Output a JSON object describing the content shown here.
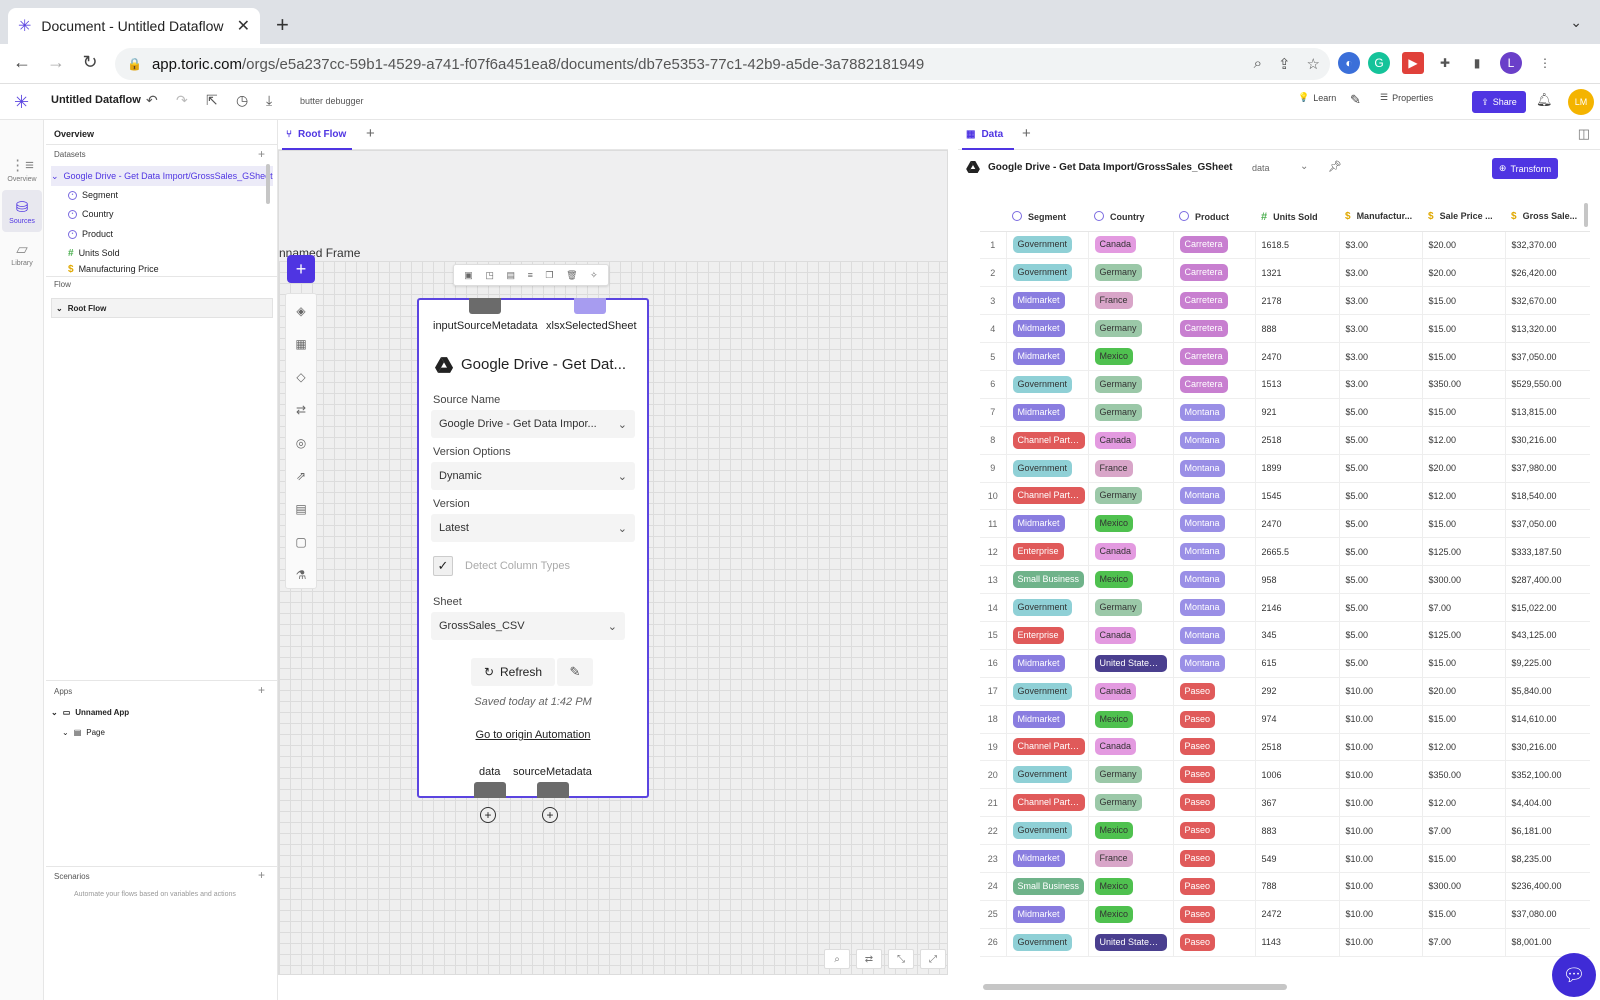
{
  "browser": {
    "tab_title": "Document - Untitled Dataflow",
    "url_host": "app.toric.com",
    "url_path": "/orgs/e5a237cc-59b1-4529-a741-f07f6a451ea8/documents/db7e5353-77c1-42b9-a5de-3a7882181949",
    "profile_initial": "L"
  },
  "header": {
    "doc_title": "Untitled Dataflow",
    "debugger_label": "butter debugger",
    "learn_label": "Learn",
    "properties_label": "Properties",
    "share_label": "Share",
    "avatar_initials": "LM"
  },
  "rail": {
    "overview": "Overview",
    "sources": "Sources",
    "library": "Library"
  },
  "left_panel": {
    "overview_title": "Overview",
    "datasets_label": "Datasets",
    "dataset_name": "Google Drive - Get Data Import/GrossSales_GSheet",
    "fields": [
      {
        "name": "Segment",
        "type": "text"
      },
      {
        "name": "Country",
        "type": "text"
      },
      {
        "name": "Product",
        "type": "text"
      },
      {
        "name": "Units Sold",
        "type": "number"
      },
      {
        "name": "Manufacturing Price",
        "type": "currency"
      }
    ],
    "flow_label": "Flow",
    "root_flow": "Root Flow",
    "apps_label": "Apps",
    "app_name": "Unnamed App",
    "page_name": "Page",
    "scenarios_label": "Scenarios",
    "scenarios_desc": "Automate your flows based on variables and actions"
  },
  "canvas": {
    "tab_label": "Root Flow",
    "frame_label": "nnamed Frame",
    "node": {
      "port_in_1": "inputSourceMetadata",
      "port_in_2": "xlsxSelectedSheet",
      "title": "Google Drive - Get Dat...",
      "source_name_label": "Source Name",
      "source_name_value": "Google Drive - Get Data Impor...",
      "version_options_label": "Version Options",
      "version_options_value": "Dynamic",
      "version_label": "Version",
      "version_value": "Latest",
      "detect_label": "Detect Column Types",
      "sheet_label": "Sheet",
      "sheet_value": "GrossSales_CSV",
      "refresh_label": "Refresh",
      "saved_text": "Saved today at 1:42 PM",
      "origin_link": "Go to origin Automation",
      "port_out_1": "data",
      "port_out_2": "sourceMetadata"
    }
  },
  "data_panel": {
    "tab_label": "Data",
    "dataset_name": "Google Drive - Get Data Import/GrossSales_GSheet",
    "output_label": "data",
    "transform_label": "Transform",
    "columns": [
      "Segment",
      "Country",
      "Product",
      "Units Sold",
      "Manufactur...",
      "Sale Price ...",
      "Gross Sale..."
    ],
    "rows": [
      [
        "Government",
        "Canada",
        "Carretera",
        "1618.5",
        "$3.00",
        "$20.00",
        "$32,370.00"
      ],
      [
        "Government",
        "Germany",
        "Carretera",
        "1321",
        "$3.00",
        "$20.00",
        "$26,420.00"
      ],
      [
        "Midmarket",
        "France",
        "Carretera",
        "2178",
        "$3.00",
        "$15.00",
        "$32,670.00"
      ],
      [
        "Midmarket",
        "Germany",
        "Carretera",
        "888",
        "$3.00",
        "$15.00",
        "$13,320.00"
      ],
      [
        "Midmarket",
        "Mexico",
        "Carretera",
        "2470",
        "$3.00",
        "$15.00",
        "$37,050.00"
      ],
      [
        "Government",
        "Germany",
        "Carretera",
        "1513",
        "$3.00",
        "$350.00",
        "$529,550.00"
      ],
      [
        "Midmarket",
        "Germany",
        "Montana",
        "921",
        "$5.00",
        "$15.00",
        "$13,815.00"
      ],
      [
        "Channel Partn...",
        "Canada",
        "Montana",
        "2518",
        "$5.00",
        "$12.00",
        "$30,216.00"
      ],
      [
        "Government",
        "France",
        "Montana",
        "1899",
        "$5.00",
        "$20.00",
        "$37,980.00"
      ],
      [
        "Channel Partn...",
        "Germany",
        "Montana",
        "1545",
        "$5.00",
        "$12.00",
        "$18,540.00"
      ],
      [
        "Midmarket",
        "Mexico",
        "Montana",
        "2470",
        "$5.00",
        "$15.00",
        "$37,050.00"
      ],
      [
        "Enterprise",
        "Canada",
        "Montana",
        "2665.5",
        "$5.00",
        "$125.00",
        "$333,187.50"
      ],
      [
        "Small Business",
        "Mexico",
        "Montana",
        "958",
        "$5.00",
        "$300.00",
        "$287,400.00"
      ],
      [
        "Government",
        "Germany",
        "Montana",
        "2146",
        "$5.00",
        "$7.00",
        "$15,022.00"
      ],
      [
        "Enterprise",
        "Canada",
        "Montana",
        "345",
        "$5.00",
        "$125.00",
        "$43,125.00"
      ],
      [
        "Midmarket",
        "United States ...",
        "Montana",
        "615",
        "$5.00",
        "$15.00",
        "$9,225.00"
      ],
      [
        "Government",
        "Canada",
        "Paseo",
        "292",
        "$10.00",
        "$20.00",
        "$5,840.00"
      ],
      [
        "Midmarket",
        "Mexico",
        "Paseo",
        "974",
        "$10.00",
        "$15.00",
        "$14,610.00"
      ],
      [
        "Channel Partn...",
        "Canada",
        "Paseo",
        "2518",
        "$10.00",
        "$12.00",
        "$30,216.00"
      ],
      [
        "Government",
        "Germany",
        "Paseo",
        "1006",
        "$10.00",
        "$350.00",
        "$352,100.00"
      ],
      [
        "Channel Partn...",
        "Germany",
        "Paseo",
        "367",
        "$10.00",
        "$12.00",
        "$4,404.00"
      ],
      [
        "Government",
        "Mexico",
        "Paseo",
        "883",
        "$10.00",
        "$7.00",
        "$6,181.00"
      ],
      [
        "Midmarket",
        "France",
        "Paseo",
        "549",
        "$10.00",
        "$15.00",
        "$8,235.00"
      ],
      [
        "Small Business",
        "Mexico",
        "Paseo",
        "788",
        "$10.00",
        "$300.00",
        "$236,400.00"
      ],
      [
        "Midmarket",
        "Mexico",
        "Paseo",
        "2472",
        "$10.00",
        "$15.00",
        "$37,080.00"
      ],
      [
        "Government",
        "United States ...",
        "Paseo",
        "1143",
        "$10.00",
        "$7.00",
        "$8,001.00"
      ]
    ]
  },
  "chip_colors": {
    "Government": "#8fd0d6",
    "Midmarket": "#8a7de0",
    "Channel Partn...": "#e05a5a",
    "Enterprise": "#e05a5a",
    "Small Business": "#6fb38a",
    "Canada": "#e39ae0",
    "Germany": "#9bc8a8",
    "France": "#d8a5c8",
    "Mexico": "#4fc14f",
    "United States ...": "#4a3f8f",
    "Carretera": "#c87fd0",
    "Montana": "#9a8fe6",
    "Paseo": "#e05a5a"
  },
  "colors": {
    "accent": "#4f35e2"
  }
}
